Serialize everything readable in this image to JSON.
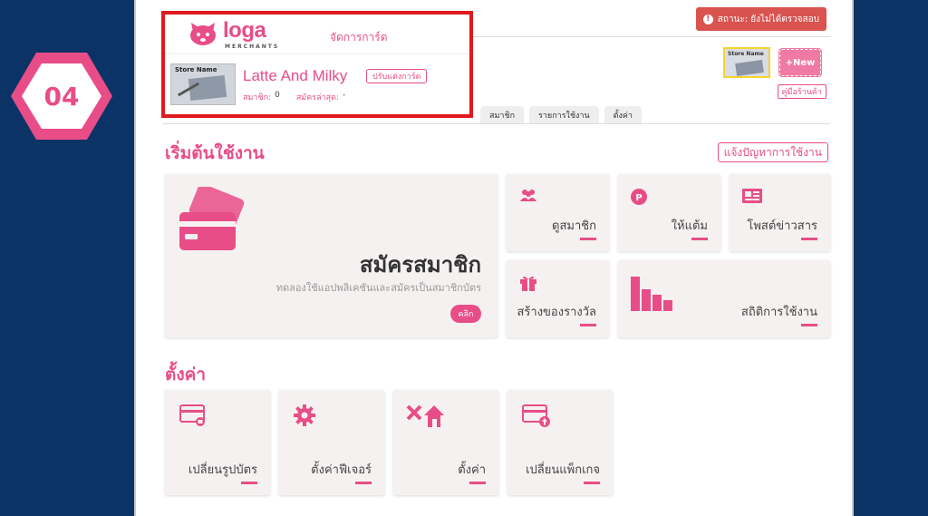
{
  "step": {
    "number": "04"
  },
  "header": {
    "status_label": "สถานะ: ยังไม่ได้ตรวจสอบ",
    "status_icon": "alert-circle-icon",
    "new_label": "+New",
    "thumb_caption": "Store Name",
    "manual_label": "คู่มือร้านค้า",
    "tabs": [
      "สมาชิก",
      "รายการใช้งาน",
      "ตั้งค่า"
    ]
  },
  "overlay": {
    "logo_text": "loga",
    "logo_sub": "MERCHANTS",
    "manage_label": "จัดการการ์ด",
    "card_caption": "Store Name",
    "shop_name": "Latte And Milky",
    "customize_label": "ปรับแต่งการ์ด",
    "members_label": "สมาชิก:",
    "members_value": "0",
    "latest_label": "สมัครล่าสุด:",
    "latest_value": "-"
  },
  "getting_started": {
    "title": "เริ่มต้นใช้งาน",
    "report_label": "แจ้งปัญหาการใช้งาน",
    "signup": {
      "title": "สมัครสมาชิก",
      "subtitle": "ทดลองใช้แอปพลิเคชันและสมัครเป็นสมาชิกบัตร",
      "button": "คลิก",
      "icon": "credit-card-icon"
    },
    "tiles": [
      {
        "label": "ดูสมาชิก",
        "icon": "users-icon"
      },
      {
        "label": "ให้แต้ม",
        "icon": "points-icon"
      },
      {
        "label": "โพสต์ข่าวสาร",
        "icon": "newspaper-icon"
      },
      {
        "label": "สร้างของรางวัล",
        "icon": "gift-icon"
      },
      {
        "label": "สถิติการใช้งาน",
        "icon": "bar-chart-icon"
      }
    ]
  },
  "settings": {
    "title": "ตั้งค่า",
    "tiles": [
      {
        "label": "เปลี่ยนรูปบัตร",
        "icon": "card-image-icon"
      },
      {
        "label": "ตั้งค่าฟีเจอร์",
        "icon": "gear-icon"
      },
      {
        "label": "ตั้งค่า",
        "icon": "tools-house-icon"
      },
      {
        "label": "เปลี่ยนแพ็กเกจ",
        "icon": "card-upgrade-icon"
      }
    ]
  },
  "colors": {
    "accent": "#e84d87",
    "highlight": "#e0191f",
    "background": "#0c3366",
    "status": "#d9534f"
  }
}
